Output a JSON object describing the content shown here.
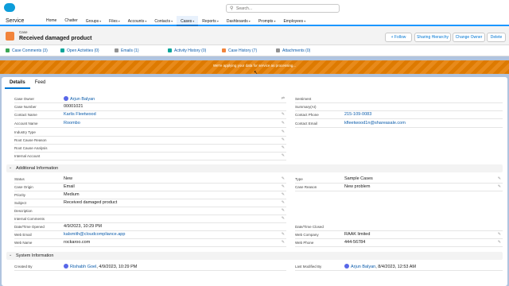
{
  "header": {
    "search_placeholder": "Search..."
  },
  "nav": {
    "app_name": "Service",
    "items": [
      {
        "label": "Home",
        "caret": ""
      },
      {
        "label": "Chatter",
        "caret": ""
      },
      {
        "label": "Groups",
        "caret": "▾"
      },
      {
        "label": "Files",
        "caret": "▾"
      },
      {
        "label": "Accounts",
        "caret": "▾"
      },
      {
        "label": "Contacts",
        "caret": "▾"
      },
      {
        "label": "Cases",
        "caret": "▾"
      },
      {
        "label": "Reports",
        "caret": "▾"
      },
      {
        "label": "Dashboards",
        "caret": "▾"
      },
      {
        "label": "Prompts",
        "caret": "▾"
      },
      {
        "label": "Employees",
        "caret": "▾"
      }
    ]
  },
  "record": {
    "object_label": "Case",
    "title": "Received damaged product",
    "buttons": {
      "follow": "+ Follow",
      "sharing": "Sharing Hierarchy",
      "change_owner": "Change Owner",
      "delete": "Delete"
    }
  },
  "related": [
    {
      "label": "Case Comments (3)",
      "color": "#3ba755"
    },
    {
      "label": "Open Activities (0)",
      "color": "#06a59a"
    },
    {
      "label": "Emails (1)",
      "color": "#939393"
    },
    {
      "label": "Activity History (0)",
      "color": "#06a59a"
    },
    {
      "label": "Case History (7)",
      "color": "#f2843b"
    },
    {
      "label": "Attachments (0)",
      "color": "#939393"
    }
  ],
  "banner": {
    "text": "We're applying your data for service as processing..."
  },
  "tabs": {
    "details": "Details",
    "feed": "Feed"
  },
  "details": {
    "left": [
      {
        "label": "Case Owner",
        "value": "Arjun Balyan",
        "link": true,
        "avatar": true
      },
      {
        "label": "Case Number",
        "value": "00001021"
      },
      {
        "label": "Contact Name",
        "value": "Karlis Fleetwood",
        "link": true
      },
      {
        "label": "Account Name",
        "value": "Roombo",
        "link": true
      },
      {
        "label": "Industry Type",
        "value": ""
      },
      {
        "label": "Root Cause Reason",
        "value": ""
      },
      {
        "label": "Root Cause Analysis",
        "value": ""
      },
      {
        "label": "Internal Account",
        "value": ""
      }
    ],
    "right": [
      {
        "label": "Sentiment",
        "value": ""
      },
      {
        "label": "Summary(AI)",
        "value": ""
      },
      {
        "label": "Contact Phone",
        "value": "215-109-0083",
        "link": true
      },
      {
        "label": "Contact Email",
        "value": "kfleetwood1n@shareasale.com",
        "link": true
      }
    ]
  },
  "additional": {
    "title": "Additional Information",
    "left": [
      {
        "label": "Status",
        "value": "New"
      },
      {
        "label": "Case Origin",
        "value": "Email"
      },
      {
        "label": "Priority",
        "value": "Medium"
      },
      {
        "label": "Subject",
        "value": "Received damaged product"
      },
      {
        "label": "Description",
        "value": ""
      },
      {
        "label": "Internal Comments",
        "value": ""
      },
      {
        "label": "Date/Time Opened",
        "value": "4/9/2023, 10:29 PM"
      },
      {
        "label": "Web Email",
        "value": "kalsmith@cloudcompliance.app",
        "link": true
      },
      {
        "label": "Web Name",
        "value": "rockaroo.com"
      }
    ],
    "right": [
      {
        "label": "Type",
        "value": "Sample Cases"
      },
      {
        "label": "Case Reason",
        "value": "New problem"
      },
      {
        "label": "Date/Time Closed",
        "value": ""
      },
      {
        "label": "Web Company",
        "value": "RAAK limited"
      },
      {
        "label": "Web Phone",
        "value": "444-56784"
      }
    ]
  },
  "system": {
    "title": "System Information",
    "created_by_label": "Created By",
    "created_by_name": "Rishabh Goel",
    "created_by_date": ", 4/9/2023, 10:29 PM",
    "modified_label": "Last Modified By",
    "modified_name": "Arjun Balyan",
    "modified_date": ", 8/4/2023, 12:53 AM"
  }
}
